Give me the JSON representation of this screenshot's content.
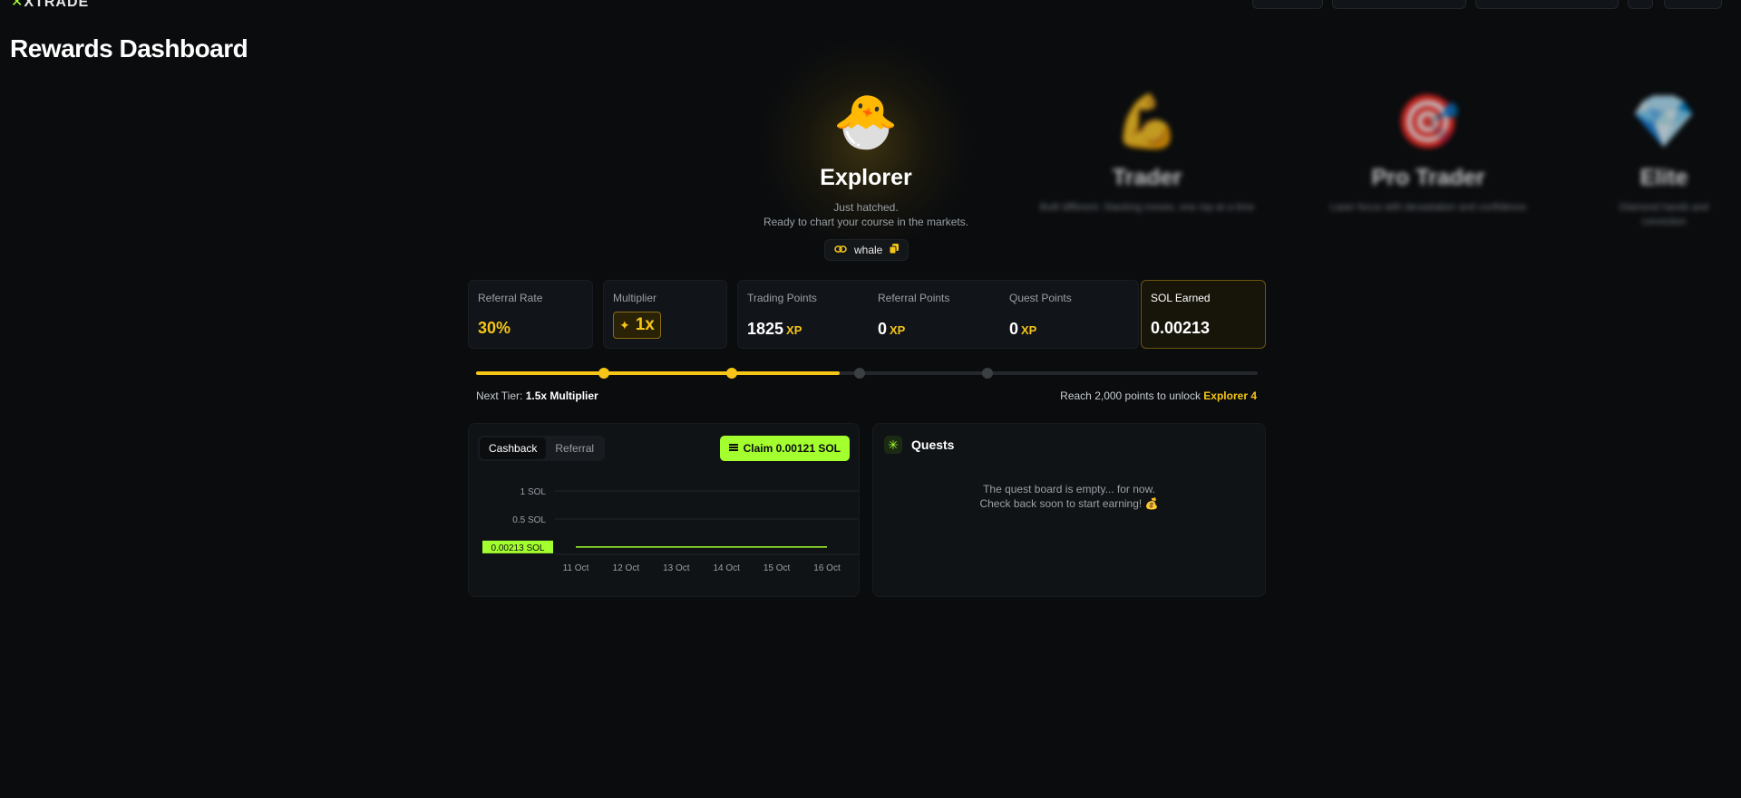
{
  "header": {
    "logo": "XTRADE"
  },
  "page": {
    "title": "Rewards Dashboard"
  },
  "tiers": [
    {
      "emoji": "🐣",
      "name": "Explorer",
      "desc_line1": "Just hatched.",
      "desc_line2": "Ready to chart your course in the markets."
    },
    {
      "emoji": "💪",
      "name": "Trader",
      "desc_line1": "Built different. Stacking moves, one rep at a time"
    },
    {
      "emoji": "🎯",
      "name": "Pro Trader",
      "desc_line1": "Laser focus with devastation and confidence"
    },
    {
      "emoji": "💎",
      "name": "Elite",
      "desc_line1": "Diamond hands and",
      "desc_line2": "conviction"
    }
  ],
  "referral": {
    "code": "whale"
  },
  "stats": {
    "referral_rate": {
      "label": "Referral Rate",
      "value": "30%"
    },
    "multiplier": {
      "label": "Multiplier",
      "value": "1x"
    },
    "trading_points": {
      "label": "Trading Points",
      "value": "1825",
      "unit": "XP"
    },
    "referral_points": {
      "label": "Referral Points",
      "value": "0",
      "unit": "XP"
    },
    "quest_points": {
      "label": "Quest Points",
      "value": "0",
      "unit": "XP"
    },
    "sol_earned": {
      "label": "SOL Earned",
      "value": "0.00213"
    }
  },
  "progress": {
    "fill_fraction": 0.465,
    "milestones": [
      0.163,
      0.327,
      0.491,
      0.654
    ],
    "next_tier_label": "Next Tier:",
    "next_tier_value": "1.5x Multiplier",
    "reach_text": "Reach 2,000 points to unlock",
    "reach_target": "Explorer 4"
  },
  "cashback_panel": {
    "tabs": [
      "Cashback",
      "Referral"
    ],
    "active_tab": "Cashback",
    "claim_label": "Claim 0.00121 SOL"
  },
  "chart_data": {
    "type": "line",
    "x": [
      "11 Oct",
      "12 Oct",
      "13 Oct",
      "14 Oct",
      "15 Oct",
      "16 Oct"
    ],
    "series": [
      {
        "values": [
          0.00213,
          0.00213,
          0.00213,
          0.00213,
          0.00213,
          0.00213
        ]
      }
    ],
    "y_ticks": [
      "1 SOL",
      "0.5 SOL"
    ],
    "current_label": "0.00213 SOL",
    "ylim": [
      0,
      1
    ],
    "grid": true,
    "line_color": "#a3ff2e"
  },
  "quests": {
    "title": "Quests",
    "empty_line1": "The quest board is empty... for now.",
    "empty_line2": "Check back soon to start earning! 💰"
  },
  "colors": {
    "accent_gold": "#f5c518",
    "accent_green": "#a3ff2e",
    "background": "#0a0c0e"
  }
}
